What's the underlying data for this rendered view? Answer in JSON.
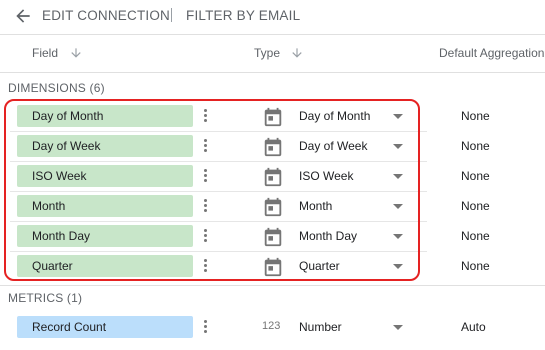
{
  "header": {
    "edit_connection": "EDIT CONNECTION",
    "filter_by_email": "FILTER BY EMAIL"
  },
  "columns": {
    "field": "Field",
    "type": "Type",
    "default_aggregation": "Default Aggregation"
  },
  "dimensions": {
    "label": "DIMENSIONS (6)",
    "rows": [
      {
        "field": "Day of Month",
        "type": "Day of Month",
        "aggregation": "None",
        "type_icon": "calendar-icon"
      },
      {
        "field": "Day of Week",
        "type": "Day of Week",
        "aggregation": "None",
        "type_icon": "calendar-icon"
      },
      {
        "field": "ISO Week",
        "type": "ISO Week",
        "aggregation": "None",
        "type_icon": "calendar-icon"
      },
      {
        "field": "Month",
        "type": "Month",
        "aggregation": "None",
        "type_icon": "calendar-icon"
      },
      {
        "field": "Month Day",
        "type": "Month Day",
        "aggregation": "None",
        "type_icon": "calendar-icon"
      },
      {
        "field": "Quarter",
        "type": "Quarter",
        "aggregation": "None",
        "type_icon": "calendar-icon"
      }
    ]
  },
  "metrics": {
    "label": "METRICS (1)",
    "rows": [
      {
        "field": "Record Count",
        "type": "Number",
        "aggregation": "Auto",
        "type_icon": "number-icon",
        "type_glyph": "123"
      }
    ]
  },
  "colors": {
    "dimension_chip": "#c8e6c9",
    "metric_chip": "#bbdefb",
    "highlight_border": "#e52222"
  }
}
